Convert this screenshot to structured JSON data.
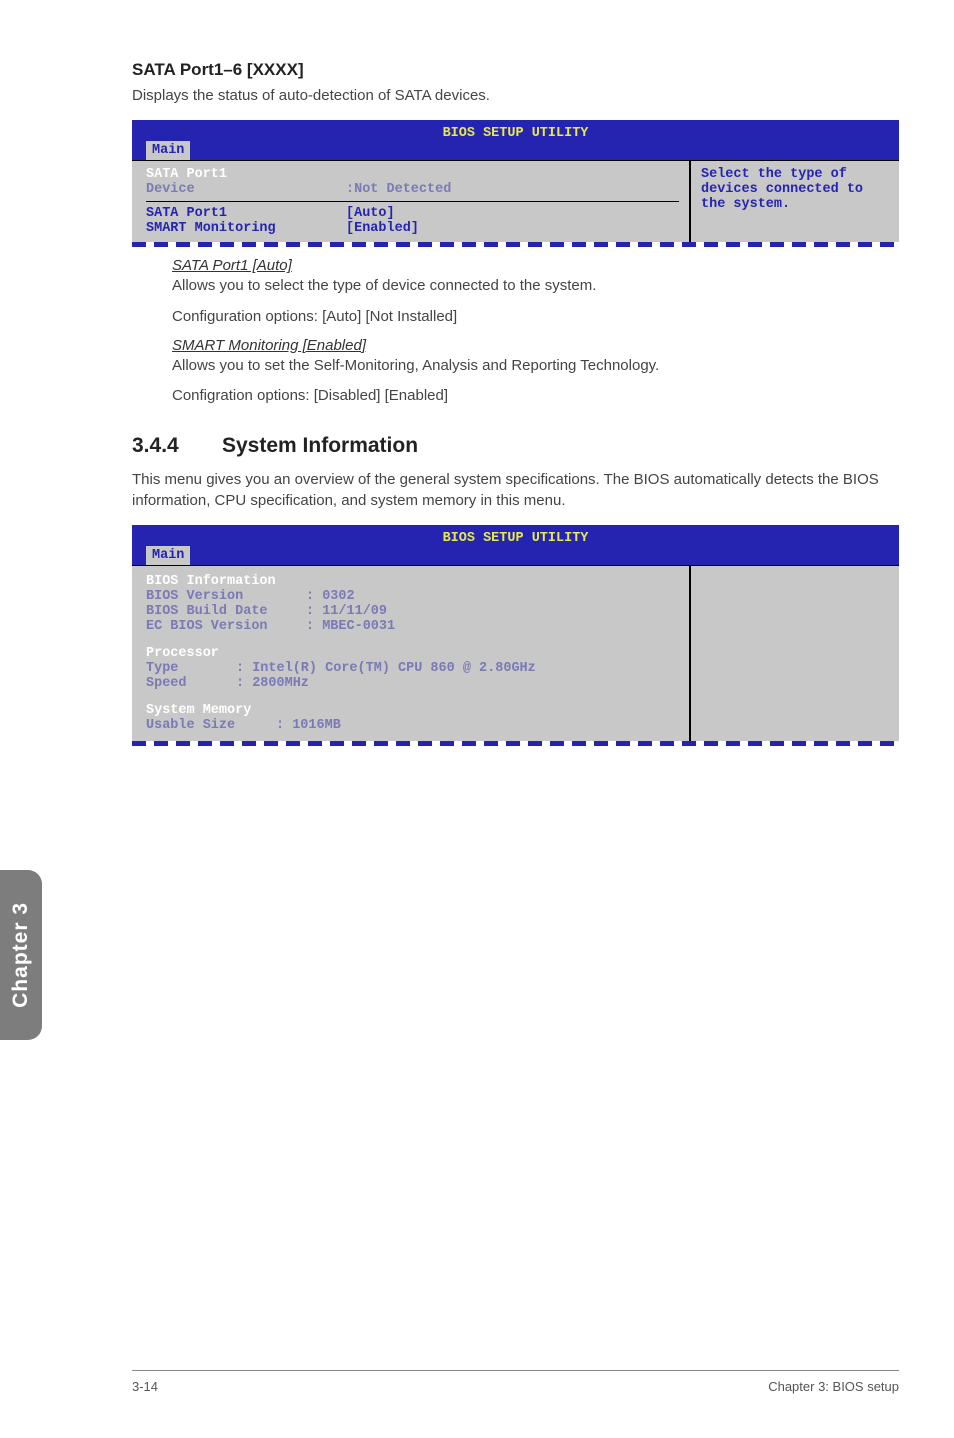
{
  "sata_section": {
    "heading": "SATA Port1–6 [XXXX]",
    "intro": "Displays the status of auto-detection of SATA devices."
  },
  "bios1": {
    "title": "BIOS SETUP UTILITY",
    "tab": "Main",
    "help": "Select the type of devices connected to the system.",
    "group_label": "SATA Port1",
    "device_label": "Device",
    "device_value": ":Not Detected",
    "rows": [
      {
        "label": "SATA Port1",
        "value": "[Auto]"
      },
      {
        "label": "SMART Monitoring",
        "value": "[Enabled]"
      }
    ]
  },
  "opt1": {
    "title": "SATA Port1 [Auto]",
    "line1": "Allows you to select the type of device connected to the system.",
    "line2": "Configuration options: [Auto] [Not Installed]"
  },
  "opt2": {
    "title": "SMART Monitoring [Enabled]",
    "line1": "Allows you to set the Self-Monitoring, Analysis and Reporting Technology.",
    "line2": "Configration options: [Disabled] [Enabled]"
  },
  "section": {
    "num": "3.4.4",
    "title": "System Information",
    "body": "This menu gives you an overview of the general system specifications. The BIOS automatically detects the BIOS information, CPU specification, and system memory in this menu."
  },
  "bios2": {
    "title": "BIOS SETUP UTILITY",
    "tab": "Main",
    "group1": "BIOS Information",
    "bios_version_l": "BIOS Version",
    "bios_version_v": ": 0302",
    "bios_build_l": "BIOS Build Date",
    "bios_build_v": ": 11/11/09",
    "ec_bios_l": "EC BIOS Version",
    "ec_bios_v": ": MBEC-0031",
    "group2": "Processor",
    "cpu_type_l": "Type",
    "cpu_type_v": ": Intel(R) Core(TM) CPU 860 @ 2.80GHz",
    "cpu_speed_l": "Speed",
    "cpu_speed_v": ": 2800MHz",
    "group3": "System Memory",
    "mem_size_l": "Usable Size",
    "mem_size_v": ": 1016MB"
  },
  "sidetab": "Chapter 3",
  "footer_left": "3-14",
  "footer_right": "Chapter 3: BIOS setup"
}
